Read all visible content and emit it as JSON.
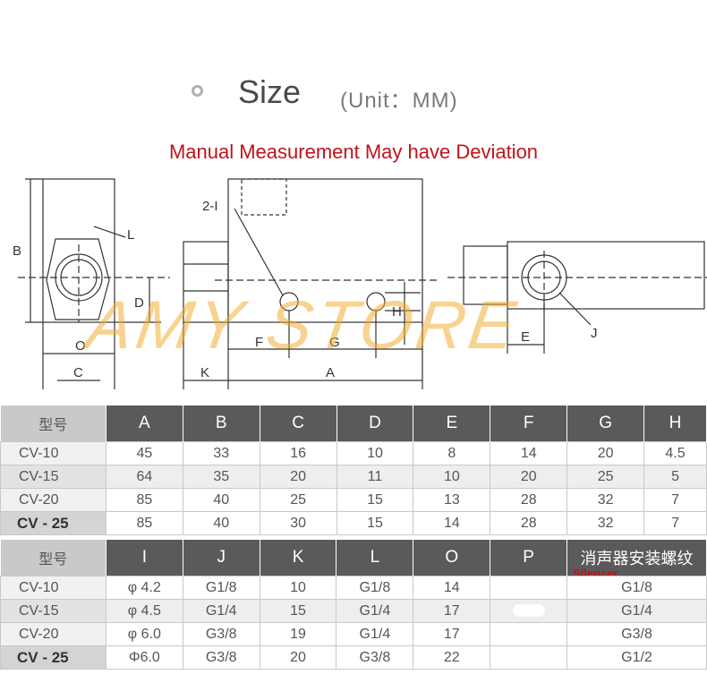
{
  "header": {
    "title": "Size",
    "unit": "(Unit：MM)",
    "warning": "Manual Measurement May have Deviation"
  },
  "watermark": "AMY STORE",
  "drawing_labels": {
    "b": "B",
    "l": "L",
    "d": "D",
    "o": "O",
    "c": "C",
    "i2": "2-I",
    "f": "F",
    "g": "G",
    "h": "H",
    "k": "K",
    "a": "A",
    "e": "E",
    "j": "J"
  },
  "table1": {
    "model_header": "型号",
    "columns": [
      "A",
      "B",
      "C",
      "D",
      "E",
      "F",
      "G",
      "H"
    ],
    "rows": [
      {
        "model": "CV-10",
        "values": [
          "45",
          "33",
          "16",
          "10",
          "8",
          "14",
          "20",
          "4.5"
        ]
      },
      {
        "model": "CV-15",
        "values": [
          "64",
          "35",
          "20",
          "11",
          "10",
          "20",
          "25",
          "5"
        ]
      },
      {
        "model": "CV-20",
        "values": [
          "85",
          "40",
          "25",
          "15",
          "13",
          "28",
          "32",
          "7"
        ]
      },
      {
        "model": "CV - 25",
        "values": [
          "85",
          "40",
          "30",
          "15",
          "14",
          "28",
          "32",
          "7"
        ]
      }
    ]
  },
  "table2": {
    "model_header": "型号",
    "columns": [
      "I",
      "J",
      "K",
      "L",
      "O",
      "P"
    ],
    "silencer_header_cn": "消声器安装螺纹",
    "silencer_header_en": "Silencer",
    "rows": [
      {
        "model": "CV-10",
        "values": [
          "φ 4.2",
          "G1/8",
          "10",
          "G1/8",
          "14",
          "",
          "G1/8"
        ]
      },
      {
        "model": "CV-15",
        "values": [
          "φ 4.5",
          "G1/4",
          "15",
          "G1/4",
          "17",
          "",
          "G1/4"
        ]
      },
      {
        "model": "CV-20",
        "values": [
          "φ 6.0",
          "G3/8",
          "19",
          "G1/4",
          "17",
          "",
          "G3/8"
        ]
      },
      {
        "model": "CV - 25",
        "values": [
          "Φ6.0",
          "G3/8",
          "20",
          "G3/8",
          "22",
          "",
          "G1/2"
        ]
      }
    ]
  }
}
